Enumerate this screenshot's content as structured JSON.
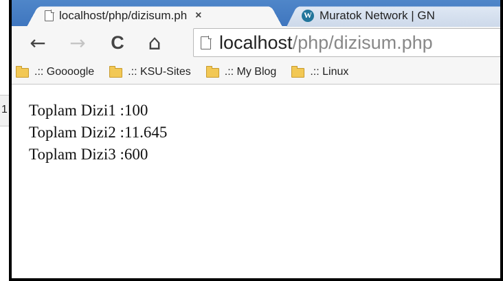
{
  "background": {
    "partial_text": "1"
  },
  "tabs": [
    {
      "title": "localhost/php/dizisum.ph",
      "close_label": "×",
      "icon": "page-icon",
      "active": true
    },
    {
      "title": "Muratok Network | GN",
      "icon": "wordpress-icon",
      "active": false
    }
  ],
  "toolbar": {
    "back_glyph": "←",
    "forward_glyph": "→",
    "reload_glyph": "C",
    "home_glyph": "⌂"
  },
  "omnibox": {
    "url_host": "localhost",
    "url_path": "/php/dizisum.php"
  },
  "bookmarks": [
    {
      "label": ".:: Goooogle",
      "icon": "folder-icon"
    },
    {
      "label": ".:: KSU-Sites",
      "icon": "folder-icon"
    },
    {
      "label": ".:: My Blog",
      "icon": "folder-icon"
    },
    {
      "label": ".:: Linux",
      "icon": "folder-icon"
    }
  ],
  "content": {
    "lines": [
      "Toplam Dizi1 :100",
      "Toplam Dizi2 :11.645",
      "Toplam Dizi3 :600"
    ]
  },
  "colors": {
    "frame_blue": "#4f86c9",
    "toolbar_bg": "#f6f6f6",
    "window_border": "#000000"
  }
}
